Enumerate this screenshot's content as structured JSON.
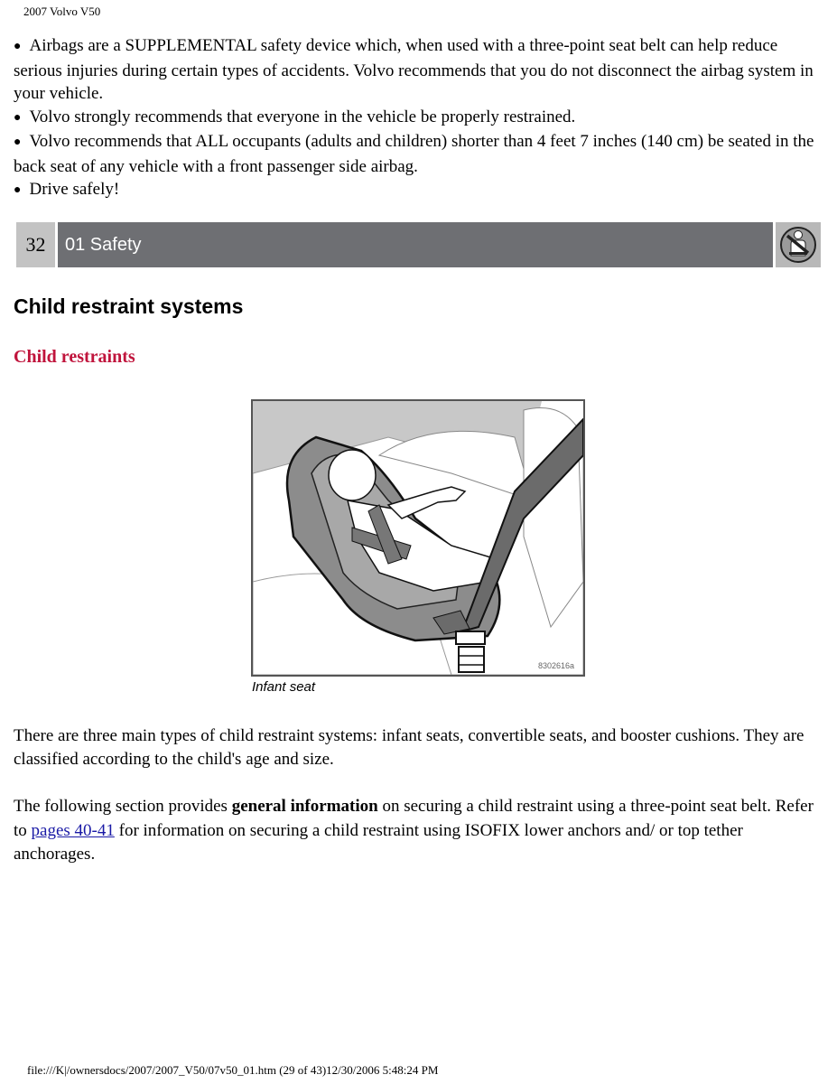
{
  "header": {
    "doc_title": "2007 Volvo V50"
  },
  "bullets": [
    {
      "text": "Airbags are a SUPPLEMENTAL safety device which, when used with a three-point seat belt can help reduce serious injuries during certain types of accidents. Volvo recommends that you do not disconnect the airbag system in your vehicle."
    },
    {
      "text": "Volvo strongly recommends that everyone in the vehicle be properly restrained."
    },
    {
      "text": "Volvo recommends that ALL occupants (adults and children) shorter than 4 feet 7 inches (140 cm) be seated in the back seat of any vehicle with a front passenger side airbag."
    },
    {
      "text": "Drive safely!"
    }
  ],
  "bullet_glyph": "●",
  "section_bar": {
    "page_number": "32",
    "section_title": "01 Safety",
    "icon": "no-seatbelt-icon",
    "colors": {
      "number_bg": "#c3c3c3",
      "title_bg": "#6e6f73",
      "icon_bg": "#b8b8b8"
    }
  },
  "page_title": "Child restraint systems",
  "subheading": {
    "text": "Child restraints",
    "color": "#c0143c"
  },
  "figure": {
    "code": "8302616a",
    "caption": "Infant seat",
    "alt": "Infant seat illustration: child in rear-facing infant seat secured with three-point seat belt"
  },
  "paragraphs": {
    "p1": "There are three main types of child restraint systems: infant seats, convertible seats, and booster cushions. They are classified according to the child's age and size.",
    "p2_before_bold": "The following section provides ",
    "p2_bold": "general information",
    "p2_after_bold": " on securing a child restraint using a three-point seat belt. Refer to ",
    "p2_link": "pages 40-41",
    "p2_after_link": " for information on securing a child restraint using ISOFIX lower anchors and/ or top tether anchorages.",
    "link_color": "#1a1aa6"
  },
  "footer": {
    "text": "file:///K|/ownersdocs/2007/2007_V50/07v50_01.htm (29 of 43)12/30/2006 5:48:24 PM"
  }
}
